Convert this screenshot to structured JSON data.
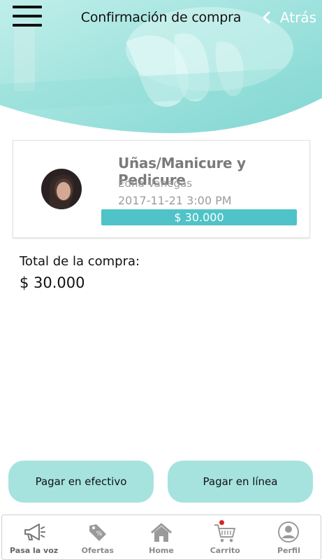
{
  "header": {
    "title": "Confirmación de compra",
    "back_label": "Atrás",
    "accent_color": "#4fc3c7"
  },
  "order": {
    "service": "Uñas/Manicure y Pedicure",
    "provider": "Edna Vanegas",
    "datetime": "2017-11-21 3:00 PM",
    "price": "$ 30.000"
  },
  "total": {
    "label": "Total de la compra:",
    "value": "$ 30.000"
  },
  "actions": {
    "pay_cash": "Pagar en efectivo",
    "pay_online": "Pagar en línea",
    "button_color": "#a6e3df"
  },
  "nav": {
    "items": [
      {
        "label": "Pasa la voz",
        "icon": "megaphone-icon"
      },
      {
        "label": "Ofertas",
        "icon": "tag-icon"
      },
      {
        "label": "Home",
        "icon": "home-icon"
      },
      {
        "label": "Carrito",
        "icon": "cart-icon"
      },
      {
        "label": "Perfil",
        "icon": "profile-icon"
      }
    ]
  }
}
